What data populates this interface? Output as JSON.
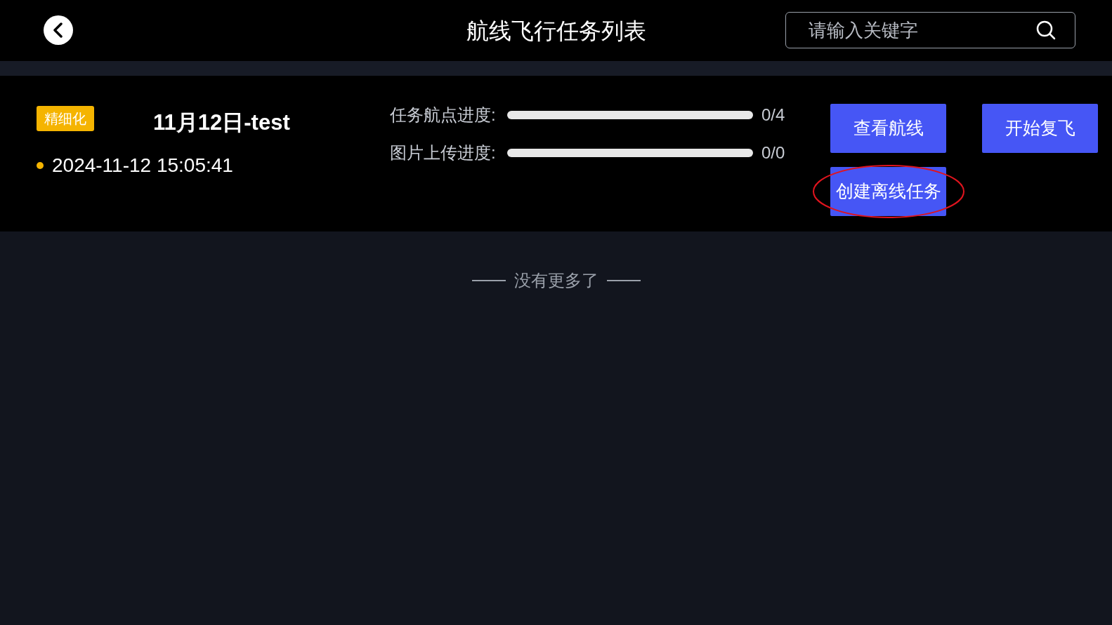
{
  "header": {
    "title": "航线飞行任务列表",
    "search": {
      "placeholder": "请输入关键字"
    }
  },
  "tasks": [
    {
      "tag": "精细化",
      "name": "11月12日-test",
      "time": "2024-11-12 15:05:41",
      "color": "#f5b400",
      "progress": [
        {
          "label": "任务航点进度:",
          "level": 0,
          "reading": "0/4"
        },
        {
          "label": "图片上传进度:",
          "level": 0,
          "reading": "0/0"
        }
      ],
      "buttons": [
        {
          "label": "查看航线",
          "highlighted": false
        },
        {
          "label": "开始复飞",
          "highlighted": false
        },
        {
          "label": "创建离线任务",
          "highlighted": true
        }
      ]
    }
  ],
  "footer_note": "没有更多了"
}
